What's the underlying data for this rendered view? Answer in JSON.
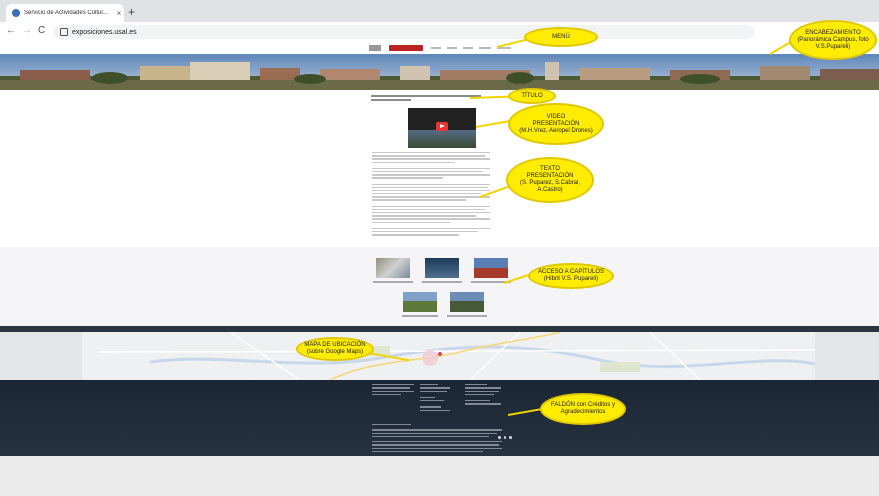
{
  "browser": {
    "tab_title": "Servicio de Actividades Cultur...",
    "tab_close": "×",
    "new_tab": "+",
    "back": "←",
    "forward": "→",
    "reload": "C",
    "url": "exposiciones.usal.es"
  },
  "annotations": {
    "menu": "MENÚ",
    "header": "ENCABEZAMIENTO\n(Panorámica Campus, foto V.S.Pupareli)",
    "title": "TÍTULO",
    "video": "VIDEO\nPRESENTACIÓN\n(M.H.Vrez, Aeropel Drones)",
    "text": "TEXTO\nPRESENTACIÓN\n(S. Puparez, S.Cabral, A.Castro)",
    "chapters": "ACCESO A CAPÍTULOS\n(Hibrit V.S. Pupareli)",
    "map": "MAPA DE UBICACIÓN\n(sobre Google Maps)",
    "footer": "FALDÓN con Créditos y Agradecimientos"
  },
  "colors": {
    "annotation": "#ffec00",
    "footer": "#1f2b38",
    "brand_red": "#b22222"
  }
}
